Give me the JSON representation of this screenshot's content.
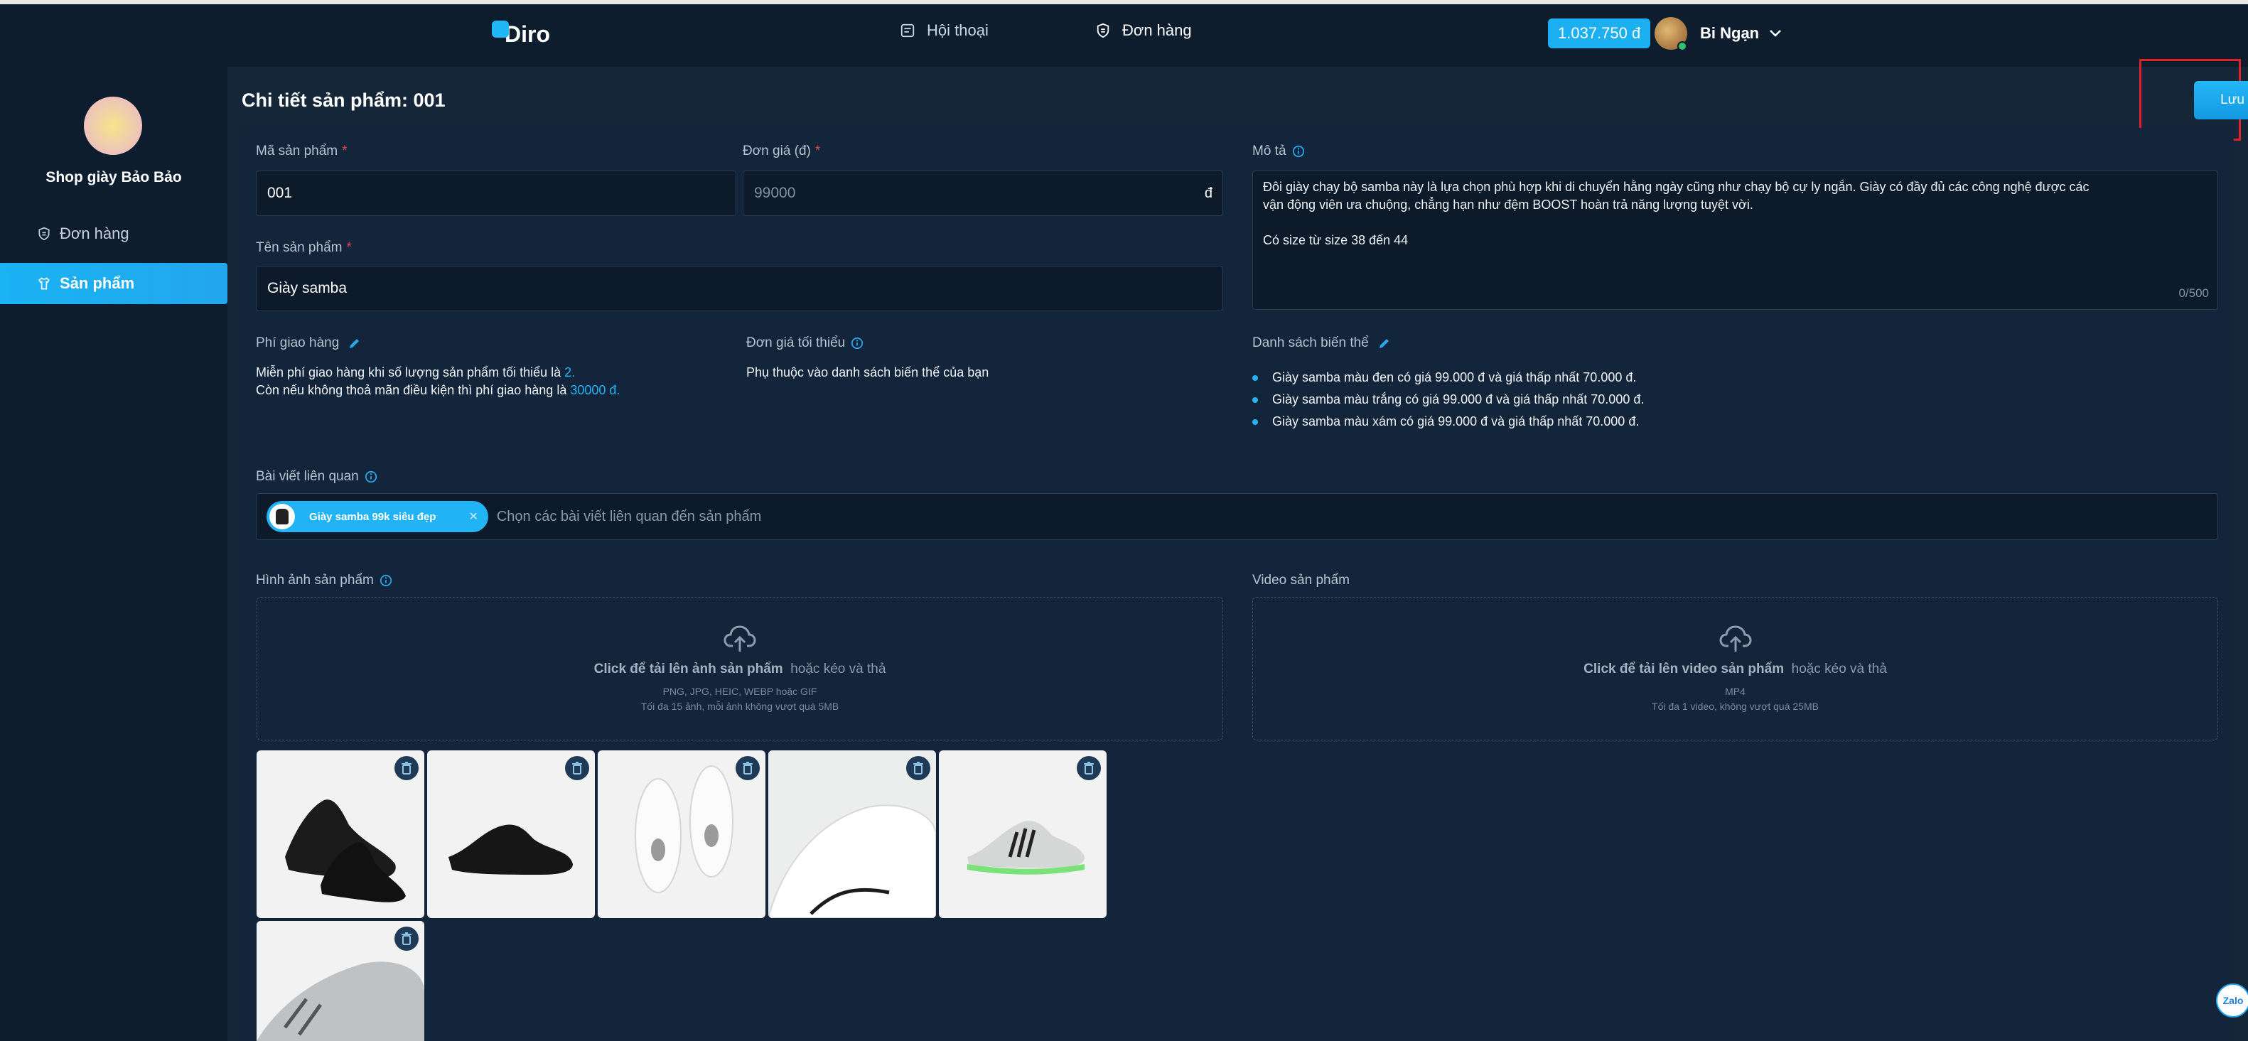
{
  "header": {
    "logo_text": "Diro",
    "nav": [
      {
        "label": "Hội thoại",
        "icon": "chat-icon"
      },
      {
        "label": "Đơn hàng",
        "icon": "shield-receipt-icon"
      }
    ],
    "balance": "1.037.750 đ",
    "user_name": "Bi Ngạn"
  },
  "sidebar": {
    "shop_name": "Shop giày Bảo Bảo",
    "items": [
      {
        "label": "Đơn hàng",
        "icon": "order-icon",
        "active": false
      },
      {
        "label": "Sản phẩm",
        "icon": "shirt-icon",
        "active": true
      }
    ]
  },
  "page": {
    "title": "Chi tiết sản phẩm: 001",
    "save_label": "Lưu"
  },
  "form": {
    "sku_label": "Mã sản phẩm",
    "sku_value": "001",
    "price_label": "Đơn giá (đ)",
    "price_value": "99000",
    "price_suffix": "đ",
    "name_label": "Tên sản phẩm",
    "name_value": "Giày samba",
    "desc_label": "Mô tả",
    "desc_line1": "Đôi giày chạy bộ samba này là lựa chọn phù hợp khi di chuyển hằng ngày cũng như chạy bộ cự ly ngắn. Giày có đầy đủ các công nghệ được các",
    "desc_line2": "vận động viên ưa chuộng, chẳng hạn như đệm BOOST hoàn trả năng lượng tuyệt vời.",
    "desc_line3": "Có size từ size 38 đến 44",
    "desc_counter": "0/500",
    "shipping_label": "Phí giao hàng",
    "shipping_line1_prefix": "Miễn phí giao hàng khi số lượng sản phẩm tối thiểu là",
    "shipping_min_qty": "2.",
    "shipping_line2_prefix": "Còn nếu không thoả mãn điều kiện thì phí giao hàng là",
    "shipping_fee": "30000 đ.",
    "min_price_label": "Đơn giá tối thiểu",
    "min_price_text": "Phụ thuộc vào danh sách biến thể của bạn",
    "variants_label": "Danh sách biến thể",
    "variants": [
      "Giày samba màu đen có giá 99.000 đ và giá thấp nhất 70.000 đ.",
      "Giày samba màu trắng có giá 99.000 đ và giá thấp nhất 70.000 đ.",
      "Giày samba màu xám có giá 99.000 đ và giá thấp nhất 70.000 đ."
    ],
    "related_label": "Bài viết liên quan",
    "related_tag": "Giày samba 99k siêu đẹp",
    "related_placeholder": "Chọn các bài viết liên quan đến sản phẩm",
    "images_label": "Hình ảnh sản phẩm",
    "images_upload_cta": "Click để tải lên ảnh sản phẩm",
    "images_upload_alt": "hoặc kéo và thả",
    "images_upload_formats": "PNG, JPG, HEIC, WEBP hoặc GIF",
    "images_upload_limits": "Tối đa 15 ảnh, mỗi ảnh không vượt quá 5MB",
    "video_label": "Video sản phẩm",
    "video_upload_cta": "Click để tải lên video sản phẩm",
    "video_upload_alt": "hoặc kéo và thả",
    "video_upload_formats": "MP4",
    "video_upload_limits": "Tối đa 1 video, không vượt quá 25MB"
  },
  "widget": {
    "label": "Zalo"
  }
}
